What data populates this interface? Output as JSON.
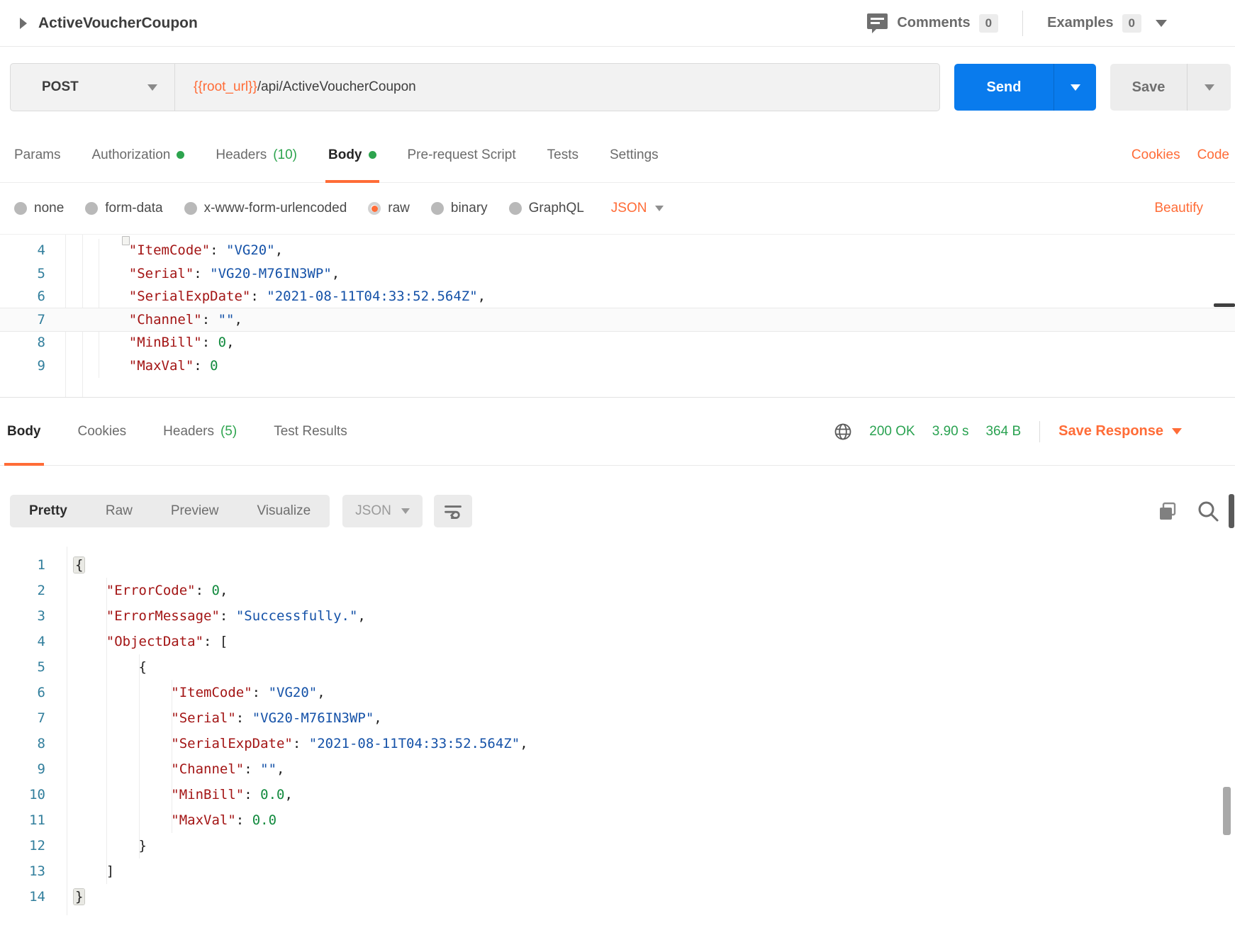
{
  "colors": {
    "accent_orange": "#FF6C37",
    "send_blue": "#097BED",
    "success_green": "#2AA251",
    "dot_green": "#2DA44E",
    "code_key_red": "#A31515",
    "code_string_blue": "#1552A8",
    "code_number_green": "#128A3E",
    "line_number_teal": "#317E9C"
  },
  "header": {
    "title": "ActiveVoucherCoupon",
    "comments_label": "Comments",
    "comments_count": "0",
    "examples_label": "Examples",
    "examples_count": "0"
  },
  "request_bar": {
    "method": "POST",
    "url_variable": "{{root_url}}",
    "url_path": "/api/ActiveVoucherCoupon",
    "send_label": "Send",
    "save_label": "Save"
  },
  "request_tabs": {
    "params": "Params",
    "authorization": "Authorization",
    "headers": "Headers",
    "headers_count": "(10)",
    "body": "Body",
    "pre_request_script": "Pre-request Script",
    "tests": "Tests",
    "settings": "Settings",
    "cookies_link": "Cookies",
    "code_link": "Code"
  },
  "body_type_row": {
    "none": "none",
    "form_data": "form-data",
    "urlencoded": "x-www-form-urlencoded",
    "raw": "raw",
    "binary": "binary",
    "graphql": "GraphQL",
    "selected": "raw",
    "format": "JSON",
    "beautify": "Beautify"
  },
  "request_editor": {
    "lines": [
      {
        "n": "4",
        "segs": [
          [
            "pln",
            "    "
          ],
          [
            "key",
            "\"ItemCode\""
          ],
          [
            "pln",
            ": "
          ],
          [
            "str",
            "\"VG20\""
          ],
          [
            "pln",
            ","
          ]
        ]
      },
      {
        "n": "5",
        "segs": [
          [
            "pln",
            "    "
          ],
          [
            "key",
            "\"Serial\""
          ],
          [
            "pln",
            ": "
          ],
          [
            "str",
            "\"VG20-M76IN3WP\""
          ],
          [
            "pln",
            ","
          ]
        ]
      },
      {
        "n": "6",
        "segs": [
          [
            "pln",
            "    "
          ],
          [
            "key",
            "\"SerialExpDate\""
          ],
          [
            "pln",
            ": "
          ],
          [
            "str",
            "\"2021-08-11T04:33:52.564Z\""
          ],
          [
            "pln",
            ","
          ]
        ]
      },
      {
        "n": "7",
        "hl": true,
        "segs": [
          [
            "pln",
            "    "
          ],
          [
            "key",
            "\"Channel\""
          ],
          [
            "pln",
            ": "
          ],
          [
            "str",
            "\"\""
          ],
          [
            "pln",
            ","
          ]
        ]
      },
      {
        "n": "8",
        "segs": [
          [
            "pln",
            "    "
          ],
          [
            "key",
            "\"MinBill\""
          ],
          [
            "pln",
            ": "
          ],
          [
            "num",
            "0"
          ],
          [
            "pln",
            ","
          ]
        ]
      },
      {
        "n": "9",
        "segs": [
          [
            "pln",
            "    "
          ],
          [
            "key",
            "\"MaxVal\""
          ],
          [
            "pln",
            ": "
          ],
          [
            "num",
            "0"
          ]
        ]
      }
    ]
  },
  "response_tabs": {
    "body": "Body",
    "cookies": "Cookies",
    "headers": "Headers",
    "headers_count": "(5)",
    "test_results": "Test Results",
    "status": "200 OK",
    "time": "3.90 s",
    "size": "364 B",
    "save_response": "Save Response"
  },
  "response_toolbar": {
    "pretty": "Pretty",
    "raw": "Raw",
    "preview": "Preview",
    "visualize": "Visualize",
    "format": "JSON"
  },
  "response_editor": {
    "lines": [
      {
        "n": "1",
        "segs": [
          [
            "bhl",
            "{"
          ]
        ]
      },
      {
        "n": "2",
        "segs": [
          [
            "pln",
            "    "
          ],
          [
            "key",
            "\"ErrorCode\""
          ],
          [
            "pln",
            ": "
          ],
          [
            "num",
            "0"
          ],
          [
            "pln",
            ","
          ]
        ]
      },
      {
        "n": "3",
        "segs": [
          [
            "pln",
            "    "
          ],
          [
            "key",
            "\"ErrorMessage\""
          ],
          [
            "pln",
            ": "
          ],
          [
            "str",
            "\"Successfully.\""
          ],
          [
            "pln",
            ","
          ]
        ]
      },
      {
        "n": "4",
        "segs": [
          [
            "pln",
            "    "
          ],
          [
            "key",
            "\"ObjectData\""
          ],
          [
            "pln",
            ": ["
          ]
        ]
      },
      {
        "n": "5",
        "segs": [
          [
            "pln",
            "        {"
          ]
        ]
      },
      {
        "n": "6",
        "segs": [
          [
            "pln",
            "            "
          ],
          [
            "key",
            "\"ItemCode\""
          ],
          [
            "pln",
            ": "
          ],
          [
            "str",
            "\"VG20\""
          ],
          [
            "pln",
            ","
          ]
        ]
      },
      {
        "n": "7",
        "segs": [
          [
            "pln",
            "            "
          ],
          [
            "key",
            "\"Serial\""
          ],
          [
            "pln",
            ": "
          ],
          [
            "str",
            "\"VG20-M76IN3WP\""
          ],
          [
            "pln",
            ","
          ]
        ]
      },
      {
        "n": "8",
        "segs": [
          [
            "pln",
            "            "
          ],
          [
            "key",
            "\"SerialExpDate\""
          ],
          [
            "pln",
            ": "
          ],
          [
            "str",
            "\"2021-08-11T04:33:52.564Z\""
          ],
          [
            "pln",
            ","
          ]
        ]
      },
      {
        "n": "9",
        "segs": [
          [
            "pln",
            "            "
          ],
          [
            "key",
            "\"Channel\""
          ],
          [
            "pln",
            ": "
          ],
          [
            "str",
            "\"\""
          ],
          [
            "pln",
            ","
          ]
        ]
      },
      {
        "n": "10",
        "segs": [
          [
            "pln",
            "            "
          ],
          [
            "key",
            "\"MinBill\""
          ],
          [
            "pln",
            ": "
          ],
          [
            "num",
            "0.0"
          ],
          [
            "pln",
            ","
          ]
        ]
      },
      {
        "n": "11",
        "segs": [
          [
            "pln",
            "            "
          ],
          [
            "key",
            "\"MaxVal\""
          ],
          [
            "pln",
            ": "
          ],
          [
            "num",
            "0.0"
          ]
        ]
      },
      {
        "n": "12",
        "segs": [
          [
            "pln",
            "        }"
          ]
        ]
      },
      {
        "n": "13",
        "segs": [
          [
            "pln",
            "    ]"
          ]
        ]
      },
      {
        "n": "14",
        "segs": [
          [
            "bhl",
            "}"
          ]
        ]
      }
    ]
  }
}
